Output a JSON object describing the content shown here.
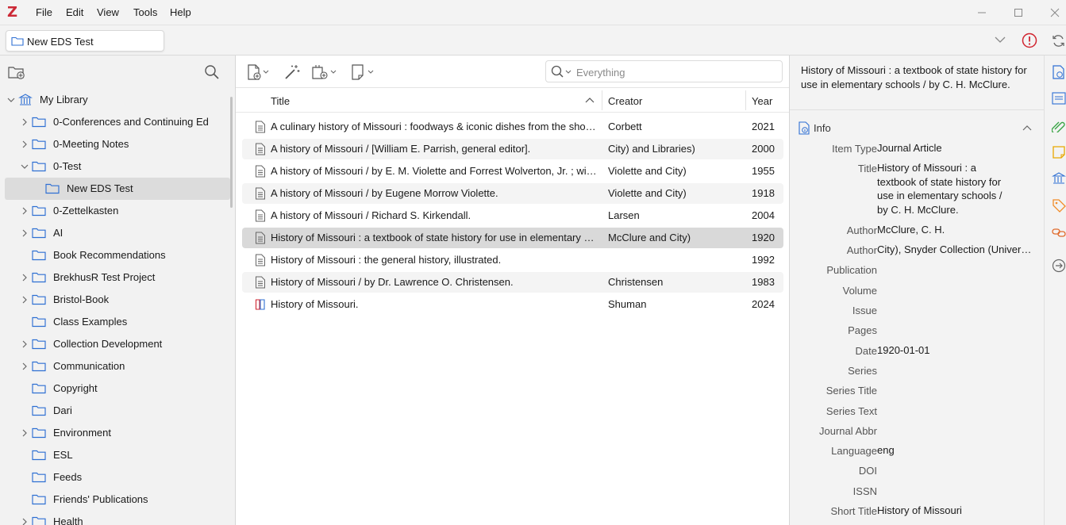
{
  "app": {
    "logo": "Z"
  },
  "menubar": [
    "File",
    "Edit",
    "View",
    "Tools",
    "Help"
  ],
  "tab": {
    "label": "New EDS Test"
  },
  "collections": [
    {
      "label": "My Library",
      "twisty": "down",
      "icon": "library",
      "indent": 0
    },
    {
      "label": "0-Conferences and Continuing Ed",
      "twisty": "right",
      "icon": "folder",
      "indent": 1
    },
    {
      "label": "0-Meeting Notes",
      "twisty": "right",
      "icon": "folder",
      "indent": 1
    },
    {
      "label": "0-Test",
      "twisty": "down",
      "icon": "folder",
      "indent": 1
    },
    {
      "label": "New EDS Test",
      "twisty": "",
      "icon": "folder",
      "indent": 2,
      "selected": true
    },
    {
      "label": "0-Zettelkasten",
      "twisty": "right",
      "icon": "folder",
      "indent": 1
    },
    {
      "label": "AI",
      "twisty": "right",
      "icon": "folder",
      "indent": 1
    },
    {
      "label": "Book Recommendations",
      "twisty": "",
      "icon": "folder",
      "indent": 1
    },
    {
      "label": "BrekhusR Test Project",
      "twisty": "right",
      "icon": "folder",
      "indent": 1
    },
    {
      "label": "Bristol-Book",
      "twisty": "right",
      "icon": "folder",
      "indent": 1
    },
    {
      "label": "Class Examples",
      "twisty": "",
      "icon": "folder",
      "indent": 1
    },
    {
      "label": "Collection Development",
      "twisty": "right",
      "icon": "folder",
      "indent": 1
    },
    {
      "label": "Communication",
      "twisty": "right",
      "icon": "folder",
      "indent": 1
    },
    {
      "label": "Copyright",
      "twisty": "",
      "icon": "folder",
      "indent": 1
    },
    {
      "label": "Dari",
      "twisty": "",
      "icon": "folder",
      "indent": 1
    },
    {
      "label": "Environment",
      "twisty": "right",
      "icon": "folder",
      "indent": 1
    },
    {
      "label": "ESL",
      "twisty": "",
      "icon": "folder",
      "indent": 1
    },
    {
      "label": "Feeds",
      "twisty": "",
      "icon": "folder",
      "indent": 1
    },
    {
      "label": "Friends' Publications",
      "twisty": "",
      "icon": "folder",
      "indent": 1
    },
    {
      "label": "Health",
      "twisty": "right",
      "icon": "folder",
      "indent": 1
    }
  ],
  "search": {
    "placeholder": "Everything"
  },
  "columns": {
    "title": "Title",
    "creator": "Creator",
    "year": "Year"
  },
  "items": [
    {
      "title": "A culinary history of Missouri : foodways & iconic dishes from the show-me state",
      "creator": "Corbett",
      "year": "2021",
      "icon": "document"
    },
    {
      "title": "A history of Missouri / [William E. Parrish, general editor].",
      "creator": "City) and Libraries)",
      "year": "2000",
      "icon": "document"
    },
    {
      "title": "A history of Missouri / by E. M. Violette and Forrest Wolverton, Jr. ; with a foreword",
      "creator": "Violette and City)",
      "year": "1955",
      "icon": "document"
    },
    {
      "title": "A history of Missouri / by Eugene Morrow Violette.",
      "creator": "Violette and City)",
      "year": "1918",
      "icon": "document"
    },
    {
      "title": "A history of Missouri / Richard S. Kirkendall.",
      "creator": "Larsen",
      "year": "2004",
      "icon": "document"
    },
    {
      "title": "History of Missouri : a textbook of state history for use in elementary schools / by C. H. McClure.",
      "creator": "McClure and City)",
      "year": "1920",
      "icon": "document",
      "selected": true
    },
    {
      "title": "History of Missouri : the general history, illustrated.",
      "creator": "",
      "year": "1992",
      "icon": "document"
    },
    {
      "title": "History of Missouri / by Dr. Lawrence O. Christensen.",
      "creator": "Christensen",
      "year": "1983",
      "icon": "document"
    },
    {
      "title": "History of Missouri.",
      "creator": "Shuman",
      "year": "2024",
      "icon": "book"
    }
  ],
  "detail": {
    "header": "History of Missouri : a textbook of state history for use in elementary schools / by C. H. McClure.",
    "section": "Info",
    "fields": [
      {
        "label": "Item Type",
        "value": "Journal Article"
      },
      {
        "label": "Title",
        "value": "History of Missouri : a textbook of state history for use in elementary schools / by C. H. McClure.",
        "lines": [
          "History of Missouri : a",
          "textbook of state history for",
          "use in elementary schools /",
          "by C. H. McClure."
        ]
      },
      {
        "label": "Author",
        "value": "McClure, C. H."
      },
      {
        "label": "Author",
        "value": "City), Snyder Collection (University of Missouri--Kansas"
      },
      {
        "label": "Publication",
        "value": ""
      },
      {
        "label": "Volume",
        "value": ""
      },
      {
        "label": "Issue",
        "value": ""
      },
      {
        "label": "Pages",
        "value": ""
      },
      {
        "label": "Date",
        "value": "1920-01-01"
      },
      {
        "label": "Series",
        "value": ""
      },
      {
        "label": "Series Title",
        "value": ""
      },
      {
        "label": "Series Text",
        "value": ""
      },
      {
        "label": "Journal Abbr",
        "value": ""
      },
      {
        "label": "Language",
        "value": "eng"
      },
      {
        "label": "DOI",
        "value": ""
      },
      {
        "label": "ISSN",
        "value": ""
      },
      {
        "label": "Short Title",
        "value": "History of Missouri"
      }
    ]
  },
  "colors": {
    "brand": "#cc2936",
    "accent": "#2e6fd3",
    "alert": "#d1242f",
    "selection": "#d9d9d9"
  }
}
